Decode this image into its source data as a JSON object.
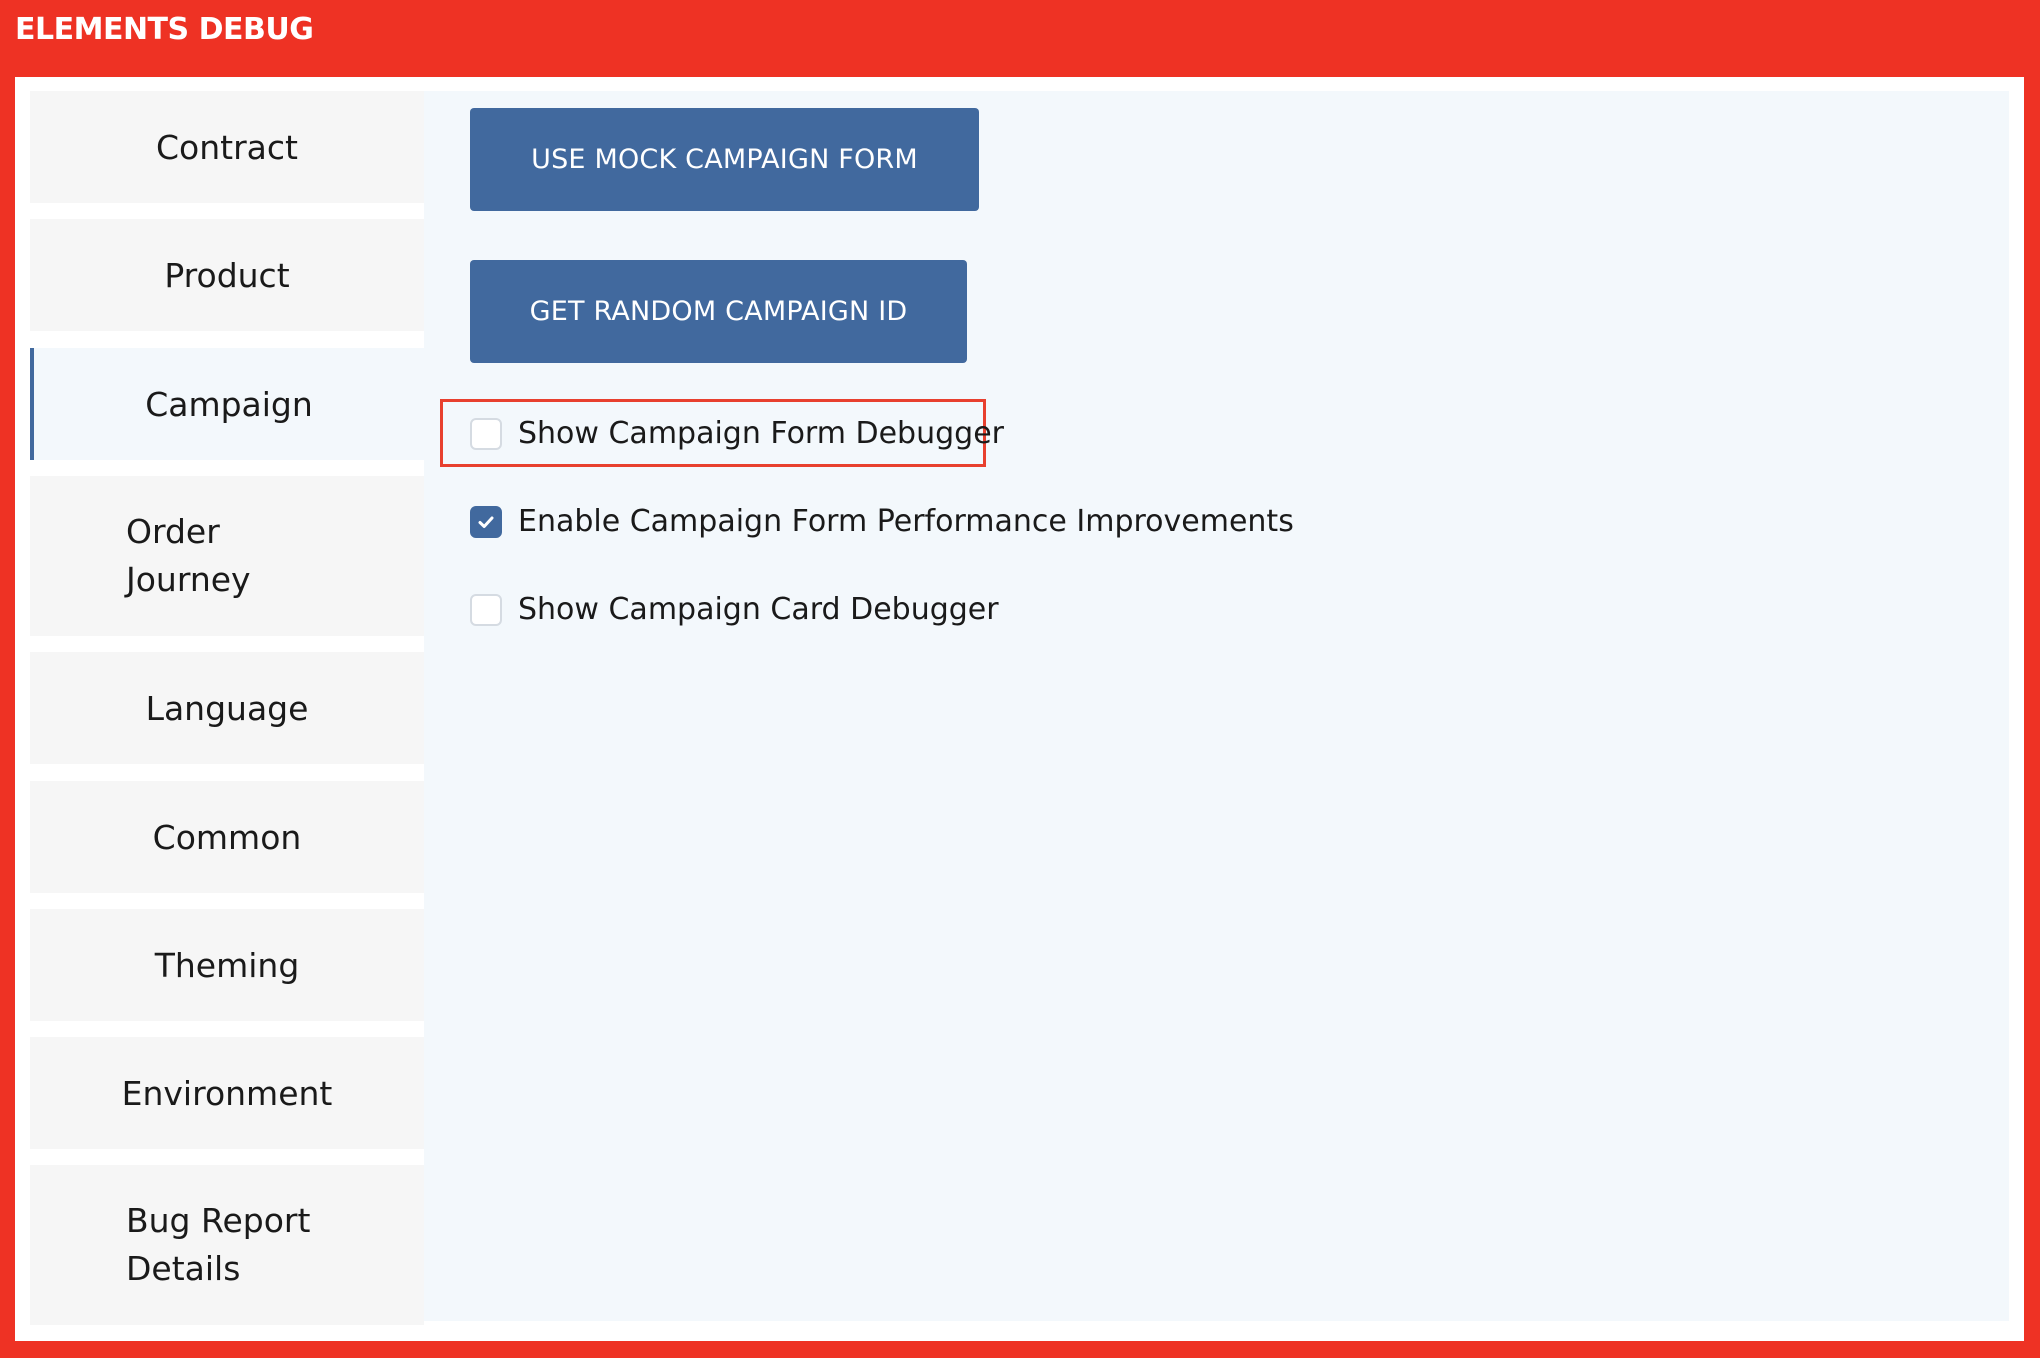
{
  "window": {
    "title": "ELEMENTS DEBUG"
  },
  "sidebar": {
    "items": [
      {
        "label": "Contract",
        "active": false
      },
      {
        "label": "Product",
        "active": false
      },
      {
        "label": "Campaign",
        "active": true
      },
      {
        "label": "Order Journey",
        "line1": "Order",
        "line2": "Journey",
        "active": false
      },
      {
        "label": "Language",
        "active": false
      },
      {
        "label": "Common",
        "active": false
      },
      {
        "label": "Theming",
        "active": false
      },
      {
        "label": "Environment",
        "active": false
      },
      {
        "label": "Bug Report Details",
        "line1": "Bug Report",
        "line2": "Details",
        "active": false
      }
    ]
  },
  "main": {
    "buttons": {
      "mock_form": "USE MOCK CAMPAIGN FORM",
      "random_id": "GET RANDOM CAMPAIGN ID"
    },
    "checkboxes": [
      {
        "label": "Show Campaign Form Debugger",
        "checked": false,
        "highlighted": true
      },
      {
        "label": "Enable Campaign Form Performance Improvements",
        "checked": true,
        "highlighted": false
      },
      {
        "label": "Show Campaign Card Debugger",
        "checked": false,
        "highlighted": false
      }
    ]
  },
  "colors": {
    "frame": "#ee3224",
    "accent": "#41699e",
    "highlight": "#e8402f",
    "content_bg": "#f3f8fc",
    "nav_bg": "#f6f6f6"
  }
}
